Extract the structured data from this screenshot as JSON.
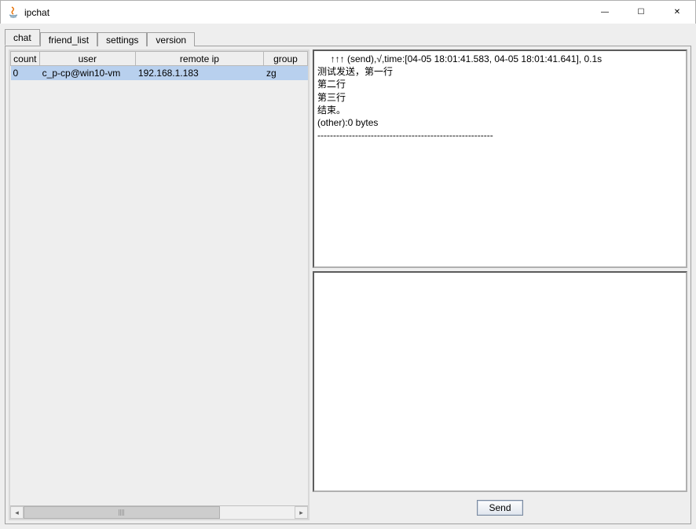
{
  "window": {
    "title": "ipchat"
  },
  "window_buttons": {
    "min": "—",
    "max": "☐",
    "close": "✕"
  },
  "tabs": [
    {
      "label": "chat",
      "active": true
    },
    {
      "label": "friend_list",
      "active": false
    },
    {
      "label": "settings",
      "active": false
    },
    {
      "label": "version",
      "active": false
    }
  ],
  "table": {
    "headers": {
      "count": "count",
      "user": "user",
      "ip": "remote ip",
      "group": "group"
    },
    "rows": [
      {
        "count": "0",
        "user": "c_p-cp@win10-vm",
        "ip": "192.168.1.183",
        "group": "zg",
        "selected": true
      }
    ]
  },
  "message_log": "     ↑↑↑ (send),√,time:[04-05 18:01:41.583, 04-05 18:01:41.641], 0.1s\n测试发送，第一行\n第二行\n第三行\n结束。\n(other):0 bytes\n--------------------------------------------------------",
  "buttons": {
    "send": "Send"
  }
}
